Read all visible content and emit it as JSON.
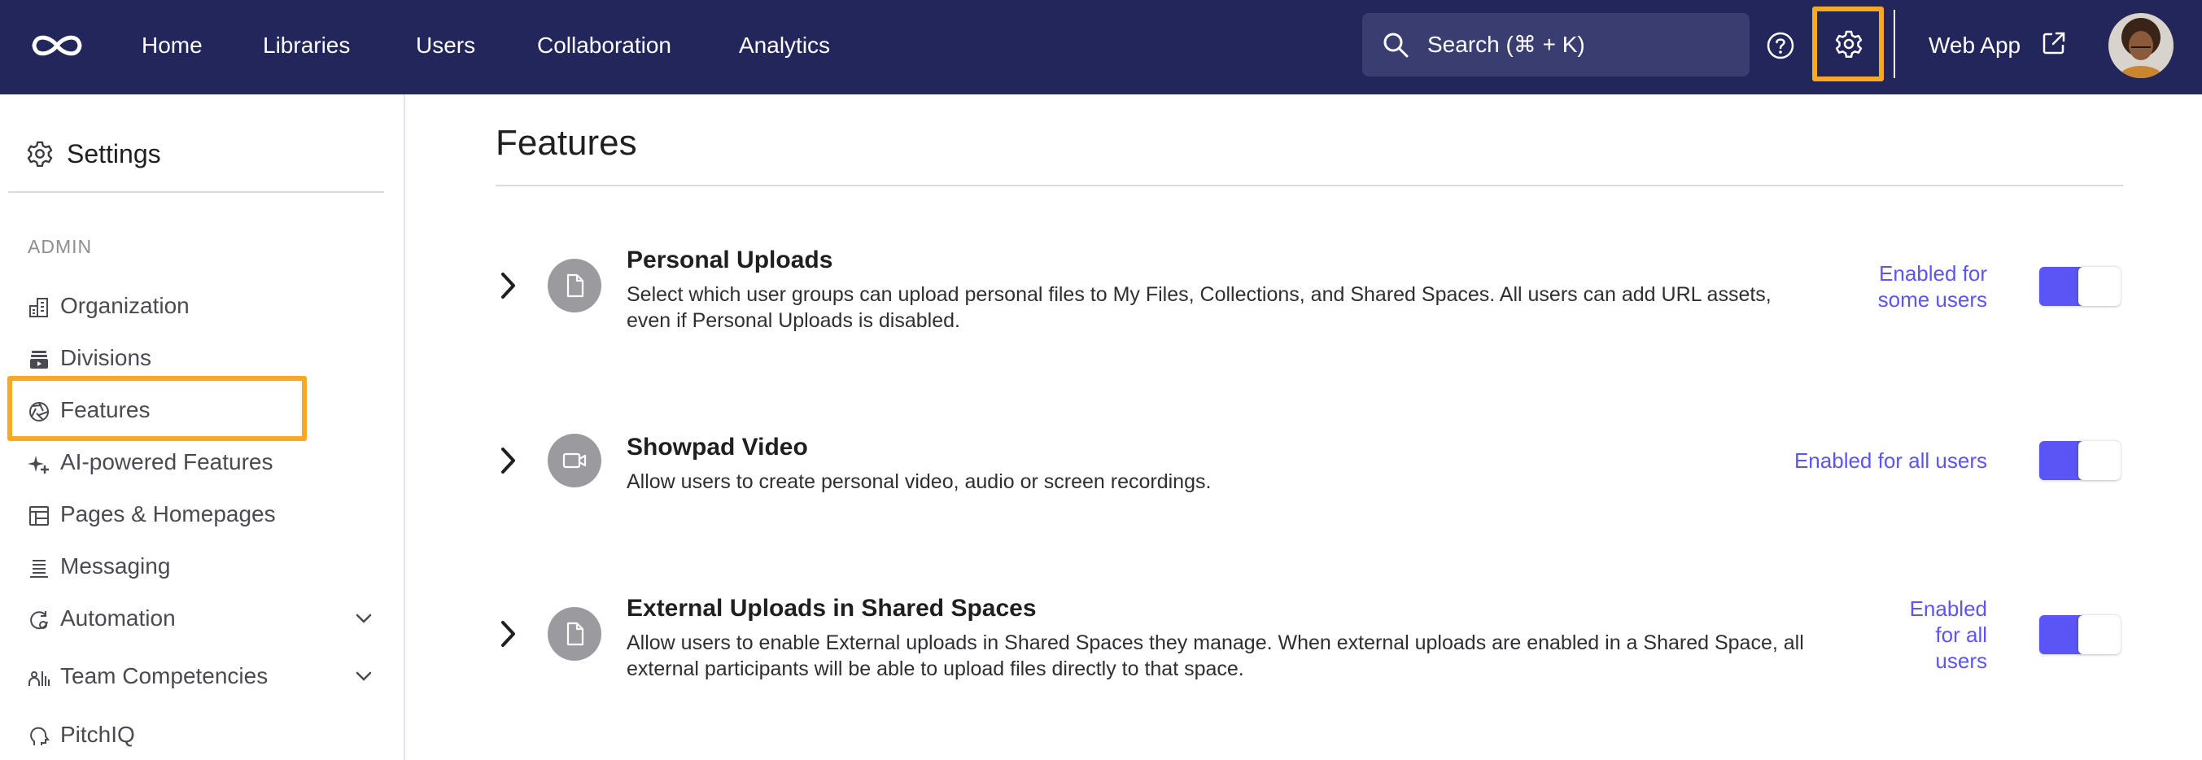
{
  "colors": {
    "topbar": "#23265a",
    "accent": "#5b55f6",
    "highlight": "#f8a823"
  },
  "nav": {
    "logo": "infinity-logo-icon",
    "links": [
      "Home",
      "Libraries",
      "Users",
      "Collaboration",
      "Analytics"
    ],
    "search_label": "Search (⌘ + K)",
    "help_icon": "help-circle-icon",
    "settings_icon": "gear-icon",
    "web_app_label": "Web App",
    "web_app_icon": "external-link-icon"
  },
  "sidebar": {
    "title": "Settings",
    "section": "ADMIN",
    "items": [
      {
        "label": "Organization",
        "icon": "building-icon"
      },
      {
        "label": "Divisions",
        "icon": "divisions-icon"
      },
      {
        "label": "Features",
        "icon": "aperture-icon"
      },
      {
        "label": "AI-powered Features",
        "icon": "sparkle-icon"
      },
      {
        "label": "Pages & Homepages",
        "icon": "layout-icon"
      },
      {
        "label": "Messaging",
        "icon": "messaging-icon"
      },
      {
        "label": "Automation",
        "icon": "automation-icon",
        "expandable": true
      },
      {
        "label": "Team Competencies",
        "icon": "team-icon",
        "expandable": true
      },
      {
        "label": "PitchIQ",
        "icon": "brain-icon"
      }
    ],
    "selected": "Features"
  },
  "main": {
    "title": "Features",
    "features": [
      {
        "title": "Personal Uploads",
        "description": "Select which user groups can upload personal files to My Files, Collections, and Shared Spaces. All users can add URL assets, even if Personal Uploads is disabled.",
        "status_lines": [
          "Enabled for",
          "some users"
        ],
        "enabled": true,
        "icon": "document-icon"
      },
      {
        "title": "Showpad Video",
        "description": "Allow users to create personal video, audio or screen recordings.",
        "status_lines": [
          "Enabled for all users"
        ],
        "enabled": true,
        "icon": "video-camera-icon"
      },
      {
        "title": "External Uploads in Shared Spaces",
        "description": "Allow users to enable External uploads in Shared Spaces they manage. When external uploads are enabled in a Shared Space, all external participants will be able to upload files directly to that space.",
        "status_lines": [
          "Enabled",
          "for all",
          "users"
        ],
        "enabled": true,
        "icon": "document-icon"
      }
    ]
  }
}
